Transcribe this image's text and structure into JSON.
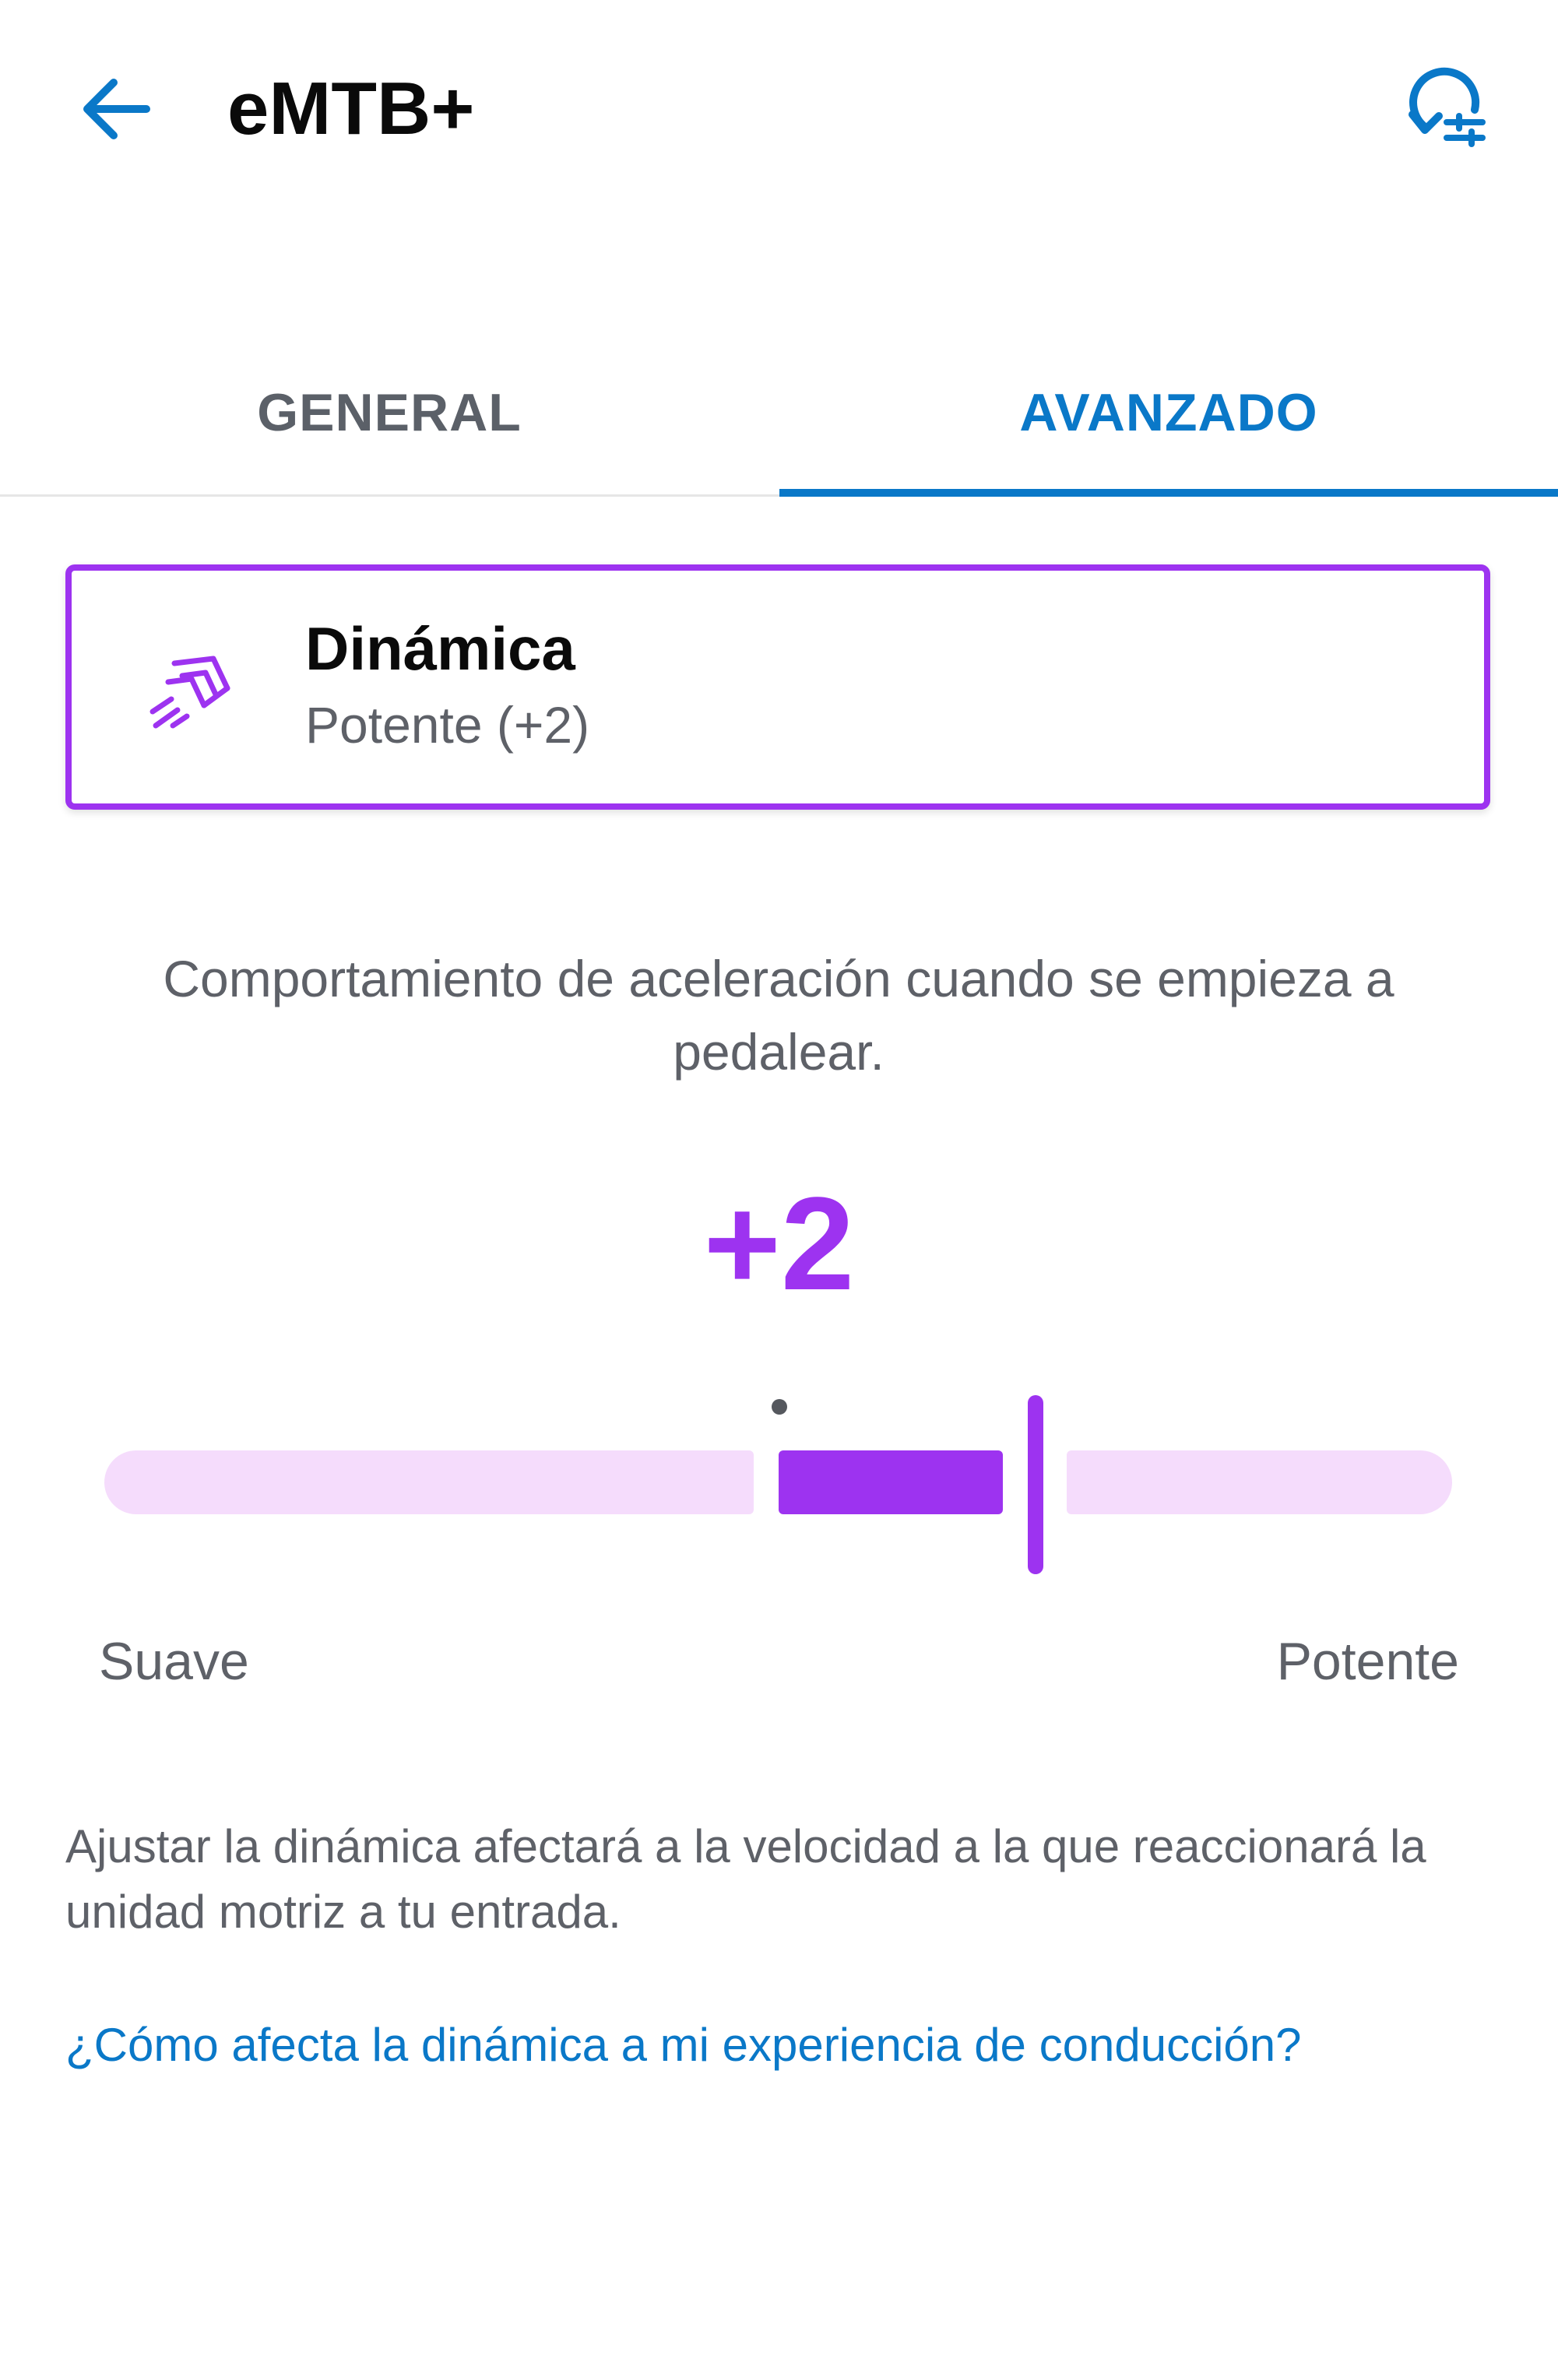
{
  "header": {
    "title": "eMTB+",
    "back_icon": "arrow-left-icon",
    "reset_icon": "reset-settings-icon"
  },
  "tabs": [
    {
      "label": "GENERAL",
      "selected": false
    },
    {
      "label": "AVANZADO",
      "selected": true
    }
  ],
  "setting_card": {
    "icon": "dynamics-chevrons-icon",
    "title": "Dinámica",
    "value": "Potente (+2)"
  },
  "description": "Comportamiento de aceleración cuando se empieza a pedalear.",
  "slider": {
    "value_label": "+2",
    "value": 2,
    "min_label": "Suave",
    "max_label": "Potente"
  },
  "note": "Ajustar la dinámica afectará a la velocidad a la que reaccionará la unidad motriz a tu entrada.",
  "help_link": "¿Cómo afecta la dinámica a mi experiencia de conducción?",
  "colors": {
    "accent_blue": "#0a78c8",
    "accent_purple": "#9d33f0",
    "track_light": "#f5dcfc",
    "text_secondary": "#5e6168"
  }
}
